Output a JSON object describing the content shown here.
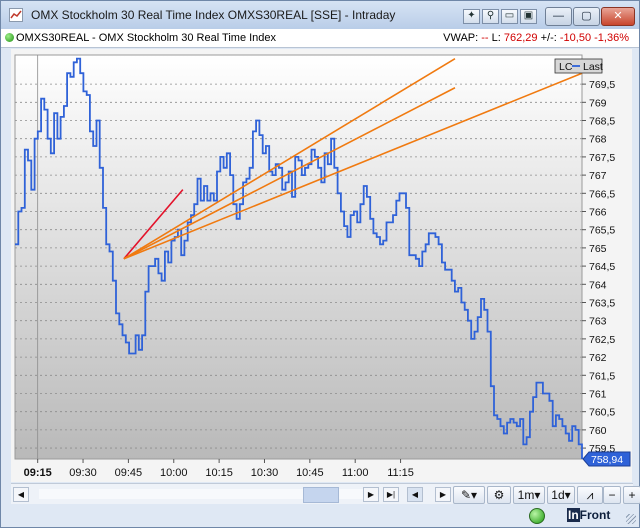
{
  "window": {
    "title": "OMX Stockholm 30 Real Time Index OMXS30REAL [SSE] - Intraday",
    "buttons": {
      "minimize": "—",
      "maximize": "▢",
      "close": "✕"
    }
  },
  "toolbar_icons": [
    "settings-icon",
    "link-icon",
    "pin-icon",
    "restore-icon"
  ],
  "info": {
    "instrument": "OMXS30REAL - OMX Stockholm 30 Real Time Index",
    "vwap_label": "VWAP:",
    "vwap_value": "--",
    "last_label": "L:",
    "last_value": "762,29",
    "change_label": "+/-:",
    "change_value": "-10,50",
    "change_pct": "-1,36%"
  },
  "chart_data": {
    "type": "line",
    "legend": [
      "LC",
      "Last"
    ],
    "legend_position": "top-right",
    "last_price_label": "758,94",
    "y_ticks": [
      "769,5",
      "769",
      "768,5",
      "768",
      "767,5",
      "767",
      "766,5",
      "766",
      "765,5",
      "765",
      "764,5",
      "764",
      "763,5",
      "763",
      "762,5",
      "762",
      "761,5",
      "761",
      "760,5",
      "760",
      "759,5"
    ],
    "ylim": [
      759.2,
      770.3
    ],
    "x_labels": [
      "09:15",
      "09:30",
      "09:45",
      "10:00",
      "10:15",
      "10:30",
      "10:45",
      "11:00",
      "11:15"
    ],
    "x_labels_bold": [
      "09:15"
    ],
    "xlim": [
      0,
      125
    ],
    "x_label_pos": [
      5,
      15,
      25,
      35,
      45,
      55,
      65,
      75,
      85
    ],
    "grid": true,
    "series": [
      {
        "name": "Last",
        "color": "#2f62d8",
        "values": [
          765.1,
          766,
          766.1,
          767.7,
          767.4,
          766.6,
          768,
          768.2,
          769.1,
          768.8,
          768,
          767.6,
          768.7,
          768,
          768.6,
          768.9,
          769.8,
          769.7,
          770.1,
          770.2,
          769.8,
          769.3,
          769.2,
          768.2,
          767.8,
          768.5,
          767.2,
          766.1,
          765.1,
          764.9,
          764.1,
          763.2,
          762.9,
          762.6,
          762.4,
          762.1,
          762.1,
          762.6,
          762.2,
          762.6,
          763.8,
          764.5,
          764.5,
          764.7,
          764.3,
          764.1,
          764.9,
          764.6,
          765.2,
          765.3,
          765.5,
          764.8,
          765.2,
          765.7,
          765.9,
          766.2,
          766.9,
          766.3,
          766.7,
          766.3,
          766.5,
          766.3,
          767.1,
          767.5,
          767.2,
          767.6,
          767,
          766.2,
          765.8,
          766.2,
          766.8,
          766.9,
          767.2,
          768.2,
          768.5,
          768.1,
          767.6,
          767.8,
          767.1,
          767,
          767.3,
          767.2,
          766.6,
          766.8,
          767.1,
          766.4,
          767.5,
          767.4,
          767,
          767.2,
          767.3,
          767.7,
          767.5,
          767.2,
          766.8,
          767.6,
          767.3,
          768,
          767.2,
          766.5,
          766,
          765.6,
          765.3,
          765.9,
          766,
          765.7,
          766.2,
          766.7,
          766.4,
          765.8,
          765.4,
          765.3,
          765.1,
          765.2,
          765.7,
          765.7,
          765.9,
          766.3,
          766.5,
          766.5,
          766.1,
          764.8,
          764.8,
          764.7,
          764.5
        ],
        "tail": [
          764.9,
          765.1,
          765.4,
          765.4,
          765.3,
          765.1,
          764.6,
          764.4,
          764.4,
          764.1,
          763.8,
          763.9,
          763.5,
          763.3,
          763,
          762.5,
          762.7,
          763.1,
          763.6,
          763.3,
          762.7,
          761.2,
          760.4,
          760.3,
          760.1,
          759.9,
          760.2,
          760.3,
          760.2,
          760.1,
          760.3,
          759.6,
          759.8,
          760.5,
          760.9,
          761.3,
          761.3,
          761,
          761,
          760.8,
          760.1,
          760.4,
          760.3,
          760.1,
          759.9,
          759.7,
          760.1,
          760,
          759.6,
          759.2
        ]
      }
    ],
    "drawings": [
      {
        "type": "trendline",
        "color": "#e3122a",
        "from": [
          24,
          764.7
        ],
        "to": [
          37,
          766.6
        ]
      },
      {
        "type": "fan",
        "color": "#f07a10",
        "origin": [
          24,
          764.7
        ],
        "to": [
          [
            97,
            769.4
          ],
          [
            97,
            770.2
          ],
          [
            125,
            769.8
          ]
        ]
      }
    ]
  },
  "scrollbar": {
    "left_arrow": "◀",
    "nav_buttons": [
      "▶",
      "▶|",
      "◀",
      "▶"
    ],
    "interval": "1m",
    "range": "1d",
    "minus": "−",
    "plus": "+"
  },
  "status": {
    "brand_in": "In",
    "brand_rest": "Front"
  }
}
